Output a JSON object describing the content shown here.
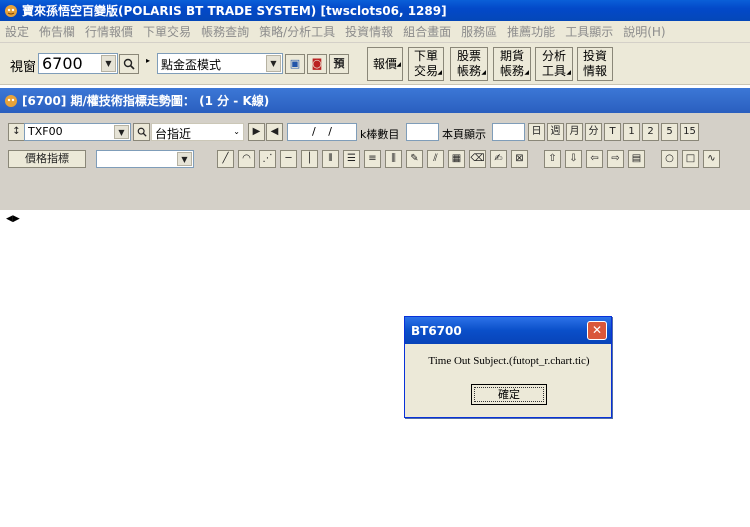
{
  "app": {
    "title": "寶來孫悟空百變版(POLARIS BT TRADE SYSTEM)   [twsclots06, 1289]"
  },
  "menu": [
    "設定",
    "佈告欄",
    "行情報價",
    "下單交易",
    "帳務查詢",
    "策略/分析工具",
    "投資情報",
    "組合畫面",
    "服務區",
    "推薦功能",
    "工具顯示",
    "說明(H)"
  ],
  "toolbar": {
    "window_label": "視窗",
    "window_value": "6700",
    "mode_value": "點金盃模式",
    "preview_label": "預",
    "buttons": [
      {
        "line1": "報價",
        "line2": ""
      },
      {
        "line1": "下單",
        "line2": "交易"
      },
      {
        "line1": "股票",
        "line2": "帳務"
      },
      {
        "line1": "期貨",
        "line2": "帳務"
      },
      {
        "line1": "分析",
        "line2": "工具"
      },
      {
        "line1": "投資",
        "line2": "情報"
      }
    ]
  },
  "child": {
    "title": "[6700] 期/權技術指標走勢圖： (1 分 - K線)",
    "symbol": "TXF00",
    "symbol_name": "台指近",
    "date_value": "/ /",
    "kbar_label": "k棒數目",
    "page_label": "本頁顯示",
    "period_buttons": [
      "日",
      "週",
      "月",
      "分",
      "T",
      "1",
      "2",
      "5",
      "15"
    ],
    "indicator_button": "價格指標"
  },
  "dialog": {
    "title": "BT6700",
    "close_glyph": "✕",
    "message": "Time Out Subject.(futopt_r.chart.tic)",
    "ok_label": "確定"
  }
}
